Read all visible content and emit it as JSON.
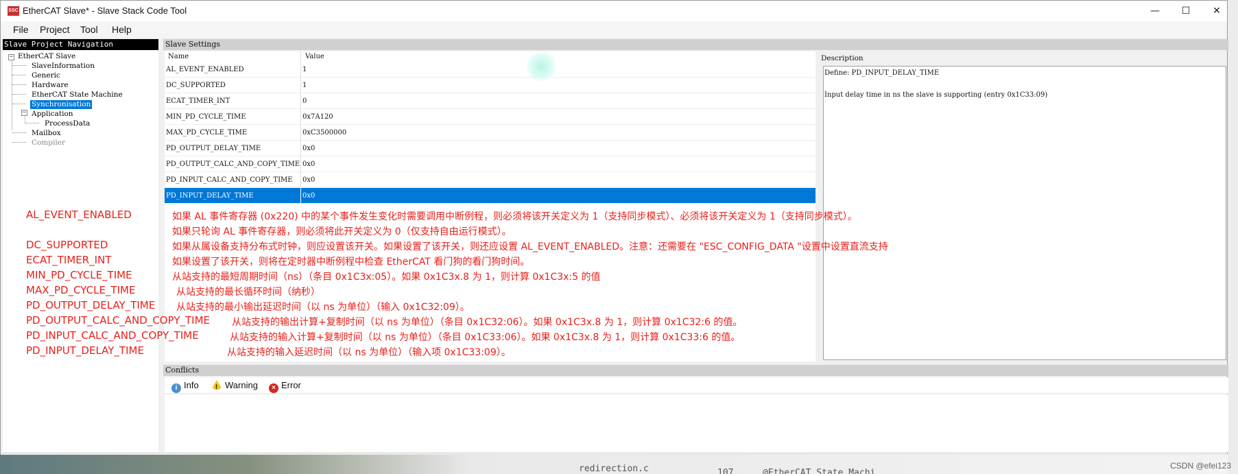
{
  "window": {
    "title": "EtherCAT Slave* - Slave Stack Code Tool",
    "icon_text": "SSC",
    "controls": {
      "minimize": "—",
      "maximize": "☐",
      "close": "✕"
    }
  },
  "menu": [
    "File",
    "Project",
    "Tool",
    "Help"
  ],
  "navigation": {
    "header": "Slave Project Navigation",
    "root": "EtherCAT Slave",
    "items": [
      "SlaveInformation",
      "Generic",
      "Hardware",
      "EtherCAT State Machine",
      "Synchronisation",
      "Application",
      "ProcessData",
      "Mailbox",
      "Compiler"
    ],
    "selected": "Synchronisation"
  },
  "settings": {
    "header": "Slave Settings",
    "columns": {
      "name": "Name",
      "value": "Value"
    },
    "rows": [
      {
        "name": "AL_EVENT_ENABLED",
        "value": "1"
      },
      {
        "name": "DC_SUPPORTED",
        "value": "1"
      },
      {
        "name": "ECAT_TIMER_INT",
        "value": "0"
      },
      {
        "name": "MIN_PD_CYCLE_TIME",
        "value": "0x7A120"
      },
      {
        "name": "MAX_PD_CYCLE_TIME",
        "value": "0xC3500000"
      },
      {
        "name": "PD_OUTPUT_DELAY_TIME",
        "value": "0x0"
      },
      {
        "name": "PD_OUTPUT_CALC_AND_COPY_TIME",
        "value": "0x0"
      },
      {
        "name": "PD_INPUT_CALC_AND_COPY_TIME",
        "value": "0x0"
      },
      {
        "name": "PD_INPUT_DELAY_TIME",
        "value": "0x0"
      }
    ],
    "selected_row": "PD_INPUT_DELAY_TIME"
  },
  "description": {
    "label": "Description",
    "line1": "Define: PD_INPUT_DELAY_TIME",
    "line2": "Input delay time in ns the slave is supporting (entry 0x1C33:09)"
  },
  "annotations": {
    "keys": [
      "AL_EVENT_ENABLED",
      "DC_SUPPORTED",
      "ECAT_TIMER_INT",
      "MIN_PD_CYCLE_TIME",
      "MAX_PD_CYCLE_TIME",
      "PD_OUTPUT_DELAY_TIME",
      "PD_OUTPUT_CALC_AND_COPY_TIME",
      "PD_INPUT_CALC_AND_COPY_TIME",
      "PD_INPUT_DELAY_TIME"
    ],
    "texts": [
      "如果 AL 事件寄存器 (0x220) 中的某个事件发生变化时需要调用中断例程，则必须将该开关定义为 1（支持同步模式）、必须将该开关定义为 1（支持同步模式）。",
      "如果只轮询 AL 事件寄存器，则必须将此开关定义为 0（仅支持自由运行模式）。",
      "如果从属设备支持分布式时钟，则应设置该开关。如果设置了该开关，则还应设置 AL_EVENT_ENABLED。注意：还需要在 \"ESC_CONFIG_DATA \"设置中设置直流支持",
      "如果设置了该开关，则将在定时器中断例程中检查 EtherCAT 看门狗的看门狗时间。",
      "从站支持的最短周期时间（ns）（条目 0x1C3x:05）。如果 0x1C3x.8 为 1，则计算 0x1C3x:5 的值",
      "从站支持的最长循环时间（纳秒）",
      "从站支持的最小输出延迟时间（以 ns 为单位）（输入 0x1C32:09）。",
      "从站支持的输出计算+复制时间（以 ns 为单位）（条目 0x1C32:06）。如果 0x1C3x.8 为 1，则计算 0x1C32:6 的值。",
      "从站支持的输入计算+复制时间（以 ns 为单位）（条目 0x1C33:06）。如果 0x1C3x.8 为 1，则计算 0x1C33:6 的值。",
      "从站支持的输入延迟时间（以 ns 为单位）（输入项 0x1C33:09）。"
    ]
  },
  "conflicts": {
    "header": "Conflicts",
    "tabs": [
      "Info",
      "Warning",
      "Error"
    ]
  },
  "background": {
    "line_number": "107",
    "file_text": "redirection.c",
    "code_text": "@EtherCAT State Machi",
    "watermark": "CSDN @efei123"
  }
}
